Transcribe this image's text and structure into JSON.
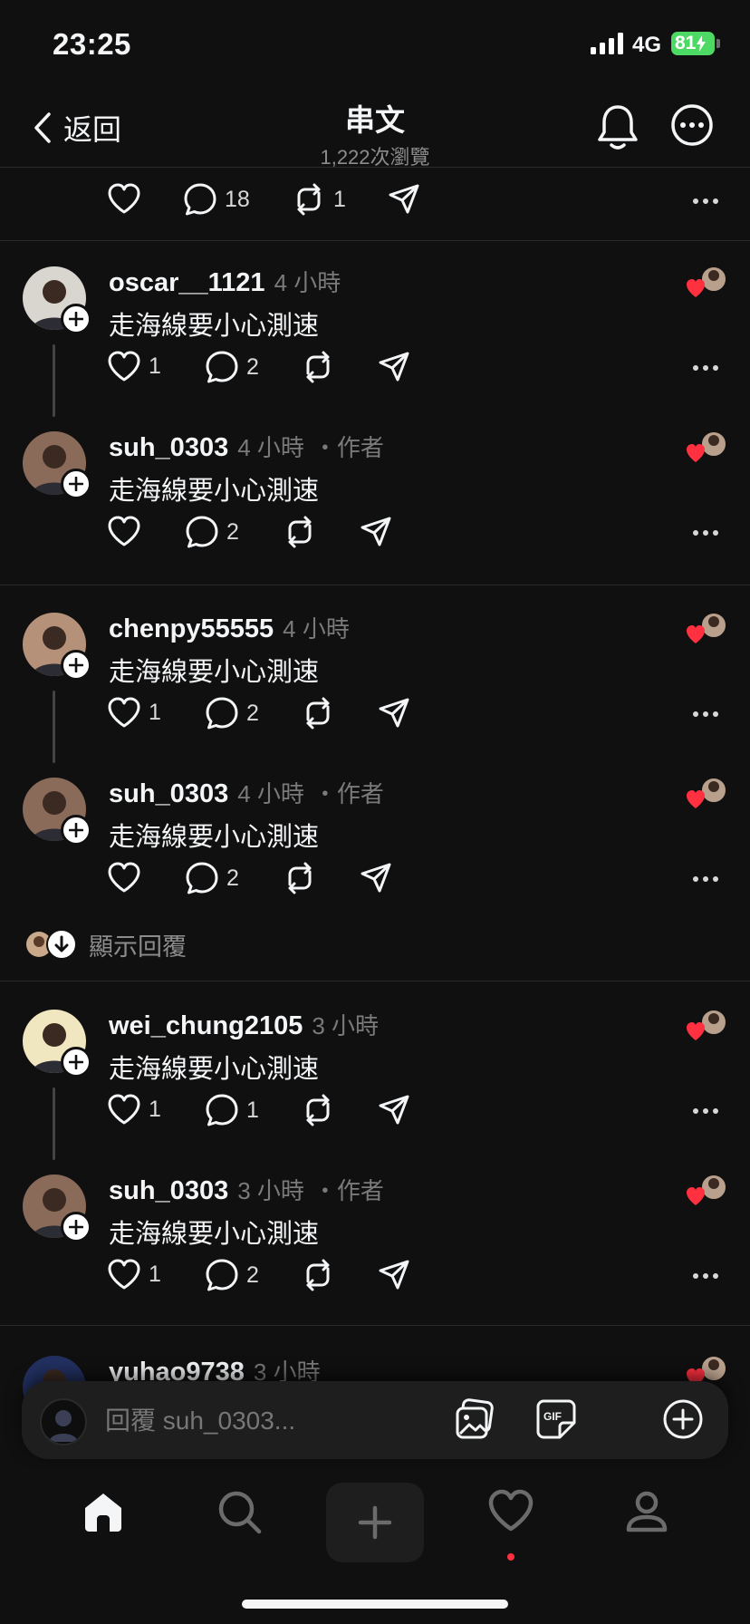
{
  "status_bar": {
    "time": "23:25",
    "network": "4G",
    "battery": "81"
  },
  "header": {
    "back_label": "返回",
    "title": "串文",
    "views": "1,222次瀏覽"
  },
  "top_actions": {
    "comments": "18",
    "reposts": "1"
  },
  "replies": [
    {
      "username": "oscar__1121",
      "time": "4 小時",
      "author_tag": "",
      "text": "走海線要小心測速",
      "likes": "1",
      "comments": "2",
      "thread_line": true
    },
    {
      "username": "suh_0303",
      "time": "4 小時",
      "author_tag": "・作者",
      "text": "走海線要小心測速",
      "likes": "",
      "comments": "2",
      "thread_line": false
    },
    {
      "username": "chenpy55555",
      "time": "4 小時",
      "author_tag": "",
      "text": "走海線要小心測速",
      "likes": "1",
      "comments": "2",
      "thread_line": true
    },
    {
      "username": "suh_0303",
      "time": "4 小時",
      "author_tag": "・作者",
      "text": "走海線要小心測速",
      "likes": "",
      "comments": "2",
      "thread_line": false
    },
    {
      "username": "wei_chung2105",
      "time": "3 小時",
      "author_tag": "",
      "text": "走海線要小心測速",
      "likes": "1",
      "comments": "1",
      "thread_line": true
    },
    {
      "username": "suh_0303",
      "time": "3 小時",
      "author_tag": "・作者",
      "text": "走海線要小心測速",
      "likes": "1",
      "comments": "2",
      "thread_line": false
    },
    {
      "username": "yuhao9738",
      "time": "3 小時",
      "author_tag": "",
      "text": "",
      "likes": "",
      "comments": "",
      "thread_line": false
    }
  ],
  "show_replies_label": "顯示回覆",
  "composer": {
    "placeholder": "回覆 suh_0303..."
  },
  "icons": {
    "tabs": [
      "home-icon",
      "search-icon",
      "plus-icon",
      "heart-icon",
      "profile-icon"
    ],
    "composer": [
      "image-icon",
      "gif-sticker-icon",
      "add-circle-icon"
    ]
  },
  "colors": {
    "background": "#101010",
    "like_red": "#ff3040",
    "battery_green": "#4cd964"
  }
}
